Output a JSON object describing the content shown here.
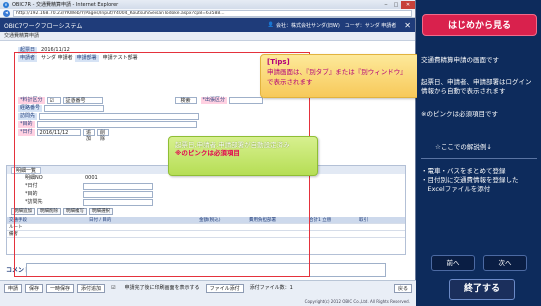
{
  "browser": {
    "title": "OBIC7R - 交通費精算申請 - Internet Explorer",
    "url": "http://192.168.70.23/YKWeb/Y/Pages/Input/Y4004_KoutsuhiSeisanTodoke.aspx?cp8=63588..."
  },
  "app": {
    "name": "OBIC7ワークフローシステム",
    "user": "会社：株式会社サンダ(旧W)　ユーザ：サンダ 申請者",
    "section": "交通費精算申請"
  },
  "form": {
    "date_label": "起票日",
    "date_value": "2016/11/12",
    "applicant_label": "申請者",
    "applicant_value": "サンダ 申請者",
    "dept_label": "申請部署",
    "dept_value": "申請テスト部署",
    "fee_label": "*料計区分",
    "fee_value": "証憑番号",
    "route_label": "経路番号",
    "dest_label": "訪問先",
    "purpose_label": "*目的",
    "date2_label": "*日付",
    "date2_value": "2016/11/12",
    "search_btn": "検索",
    "kind_label": "*出張区分",
    "add_btn": "追加",
    "delete_btn": "削除"
  },
  "panel": {
    "tab": "明細一覧",
    "no_label": "明細NO",
    "no_value": "0001",
    "date_label": "*日付",
    "purpose_label": "*目的",
    "dest_label": "*訪問先",
    "buttons": [
      "明細追加",
      "明細削除",
      "明細複写",
      "明細選択"
    ],
    "columns": [
      "交通手段",
      "日付 / 目的",
      "金額(税込)",
      "費用負担部署",
      "合計1 立替",
      "取引"
    ],
    "rows": [
      "ルート",
      "備考"
    ]
  },
  "comment_label": "コメント",
  "footer": {
    "buttons": [
      "申請",
      "保存",
      "一時保存",
      "添付追加"
    ],
    "checkbox": "申請完了後に印刷画面を表示する",
    "attach_btn": "ファイル添付",
    "attach_count": "添付ファイル数：1",
    "back_btn": "戻る",
    "copyright": "Copyright(c) 2012 OBIC Co.,Ltd. All Rights Reserved."
  },
  "tips": {
    "tip1_title": "[Tips]",
    "tip1_line1": "申請画面は、『別タブ』または『別ウィンドウ』",
    "tip1_line2": "で表示されます",
    "tip2_line1": "起票日,申請者,申請部署が自動設定済み",
    "tip2_line2": "※のピンクは必須項目"
  },
  "guide": {
    "start_button": "はじめから見る",
    "line1": "交通費精算申請の画面です",
    "line2": "起票日、申請者、申請部署はログイン",
    "line3": "情報から自動で表示されます",
    "line4": "※のピンクは必須項目です",
    "line5": "☆ここでの解説例↓",
    "line6": "・電車・バスをまとめて登録",
    "line7": "・目付別に交通費情報を登録した",
    "line8": "　Excelファイルを添付",
    "prev": "前へ",
    "next": "次へ",
    "end": "終了する"
  }
}
